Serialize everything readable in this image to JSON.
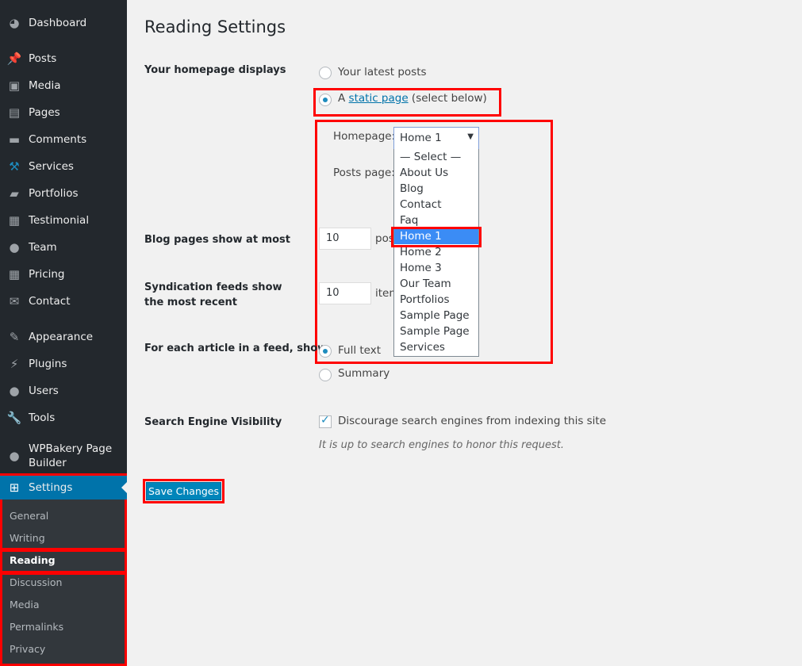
{
  "sidebar": {
    "items": [
      {
        "label": "Dashboard",
        "icon": "dashboard-icon"
      },
      {
        "label": "Posts",
        "icon": "pin-icon"
      },
      {
        "label": "Media",
        "icon": "media-icon"
      },
      {
        "label": "Pages",
        "icon": "pages-icon"
      },
      {
        "label": "Comments",
        "icon": "comments-icon"
      },
      {
        "label": "Services",
        "icon": "hammer-icon"
      },
      {
        "label": "Portfolios",
        "icon": "folder-icon"
      },
      {
        "label": "Testimonial",
        "icon": "testimonial-icon"
      },
      {
        "label": "Team",
        "icon": "user-icon"
      },
      {
        "label": "Pricing",
        "icon": "pricing-icon"
      },
      {
        "label": "Contact",
        "icon": "mail-icon"
      },
      {
        "label": "Appearance",
        "icon": "brush-icon"
      },
      {
        "label": "Plugins",
        "icon": "plugin-icon"
      },
      {
        "label": "Users",
        "icon": "users-icon"
      },
      {
        "label": "Tools",
        "icon": "wrench-icon"
      },
      {
        "label": "WPBakery Page Builder",
        "icon": "wpbakery-icon"
      },
      {
        "label": "Settings",
        "icon": "settings-icon"
      }
    ],
    "submenu": [
      "General",
      "Writing",
      "Reading",
      "Discussion",
      "Media",
      "Permalinks",
      "Privacy"
    ],
    "active_submenu": "Reading"
  },
  "main": {
    "title": "Reading Settings",
    "homepage_displays": {
      "label": "Your homepage displays",
      "opt_latest": "Your latest posts",
      "opt_static_a": "A",
      "opt_static_link": "static page",
      "opt_static_b": "(select below)",
      "selected": "static"
    },
    "homepage_label": "Homepage:",
    "homepage_value": "Home 1",
    "posts_page_label": "Posts page:",
    "dropdown_options": [
      "— Select —",
      "About Us",
      "Blog",
      "Contact",
      "Faq",
      "Home 1",
      "Home 2",
      "Home 3",
      "Our Team",
      "Portfolios",
      "Sample Page",
      "Sample Page",
      "Services"
    ],
    "dropdown_selected": "Home 1",
    "blog_pages": {
      "label": "Blog pages show at most",
      "value": "10",
      "suffix": "posts"
    },
    "syndication": {
      "label": "Syndication feeds show the most recent",
      "value": "10",
      "suffix": "items"
    },
    "feed_article": {
      "label": "For each article in a feed, show",
      "opt_full": "Full text",
      "opt_summary": "Summary",
      "selected": "full"
    },
    "search": {
      "label": "Search Engine Visibility",
      "checkbox": "Discourage search engines from indexing this site",
      "checked": true,
      "note": "It is up to search engines to honor this request."
    },
    "save_label": "Save Changes"
  },
  "colors": {
    "accent": "#0073aa",
    "highlight": "#ff0000",
    "sidebar": "#23282d"
  }
}
